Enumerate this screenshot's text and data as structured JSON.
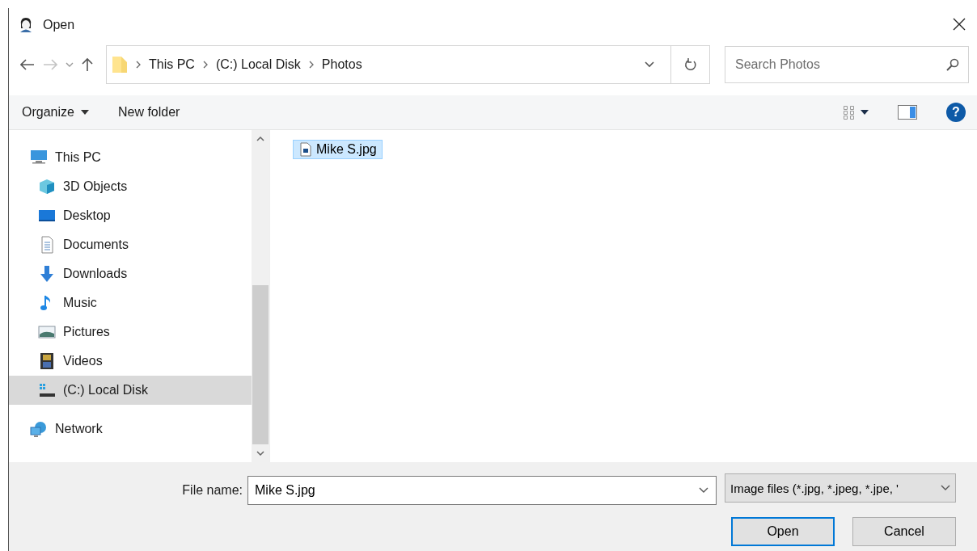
{
  "window": {
    "title": "Open"
  },
  "breadcrumb": [
    "This PC",
    "(C:) Local Disk",
    "Photos"
  ],
  "search": {
    "placeholder": "Search Photos"
  },
  "toolbar": {
    "organize": "Organize",
    "new_folder": "New folder",
    "help": "?"
  },
  "sidebar": {
    "items": [
      {
        "label": "This PC",
        "kind": "pc",
        "selected": false,
        "children": [
          {
            "label": "3D Objects",
            "kind": "objects",
            "selected": false
          },
          {
            "label": "Desktop",
            "kind": "desktop",
            "selected": false
          },
          {
            "label": "Documents",
            "kind": "documents",
            "selected": false
          },
          {
            "label": "Downloads",
            "kind": "downloads",
            "selected": false
          },
          {
            "label": "Music",
            "kind": "music",
            "selected": false
          },
          {
            "label": "Pictures",
            "kind": "pictures",
            "selected": false
          },
          {
            "label": "Videos",
            "kind": "videos",
            "selected": false
          },
          {
            "label": "(C:) Local Disk",
            "kind": "disk",
            "selected": true
          }
        ]
      },
      {
        "label": "Network",
        "kind": "network",
        "selected": false
      }
    ]
  },
  "files": [
    {
      "name": "Mike S.jpg",
      "selected": true
    }
  ],
  "file_name": {
    "label": "File name:",
    "value": "Mike S.jpg"
  },
  "file_type": "Image files (*.jpg, *.jpeg, *.jpe, '",
  "buttons": [
    {
      "label": "Open",
      "kind": "primary"
    },
    {
      "label": "Cancel",
      "kind": "secondary"
    }
  ]
}
